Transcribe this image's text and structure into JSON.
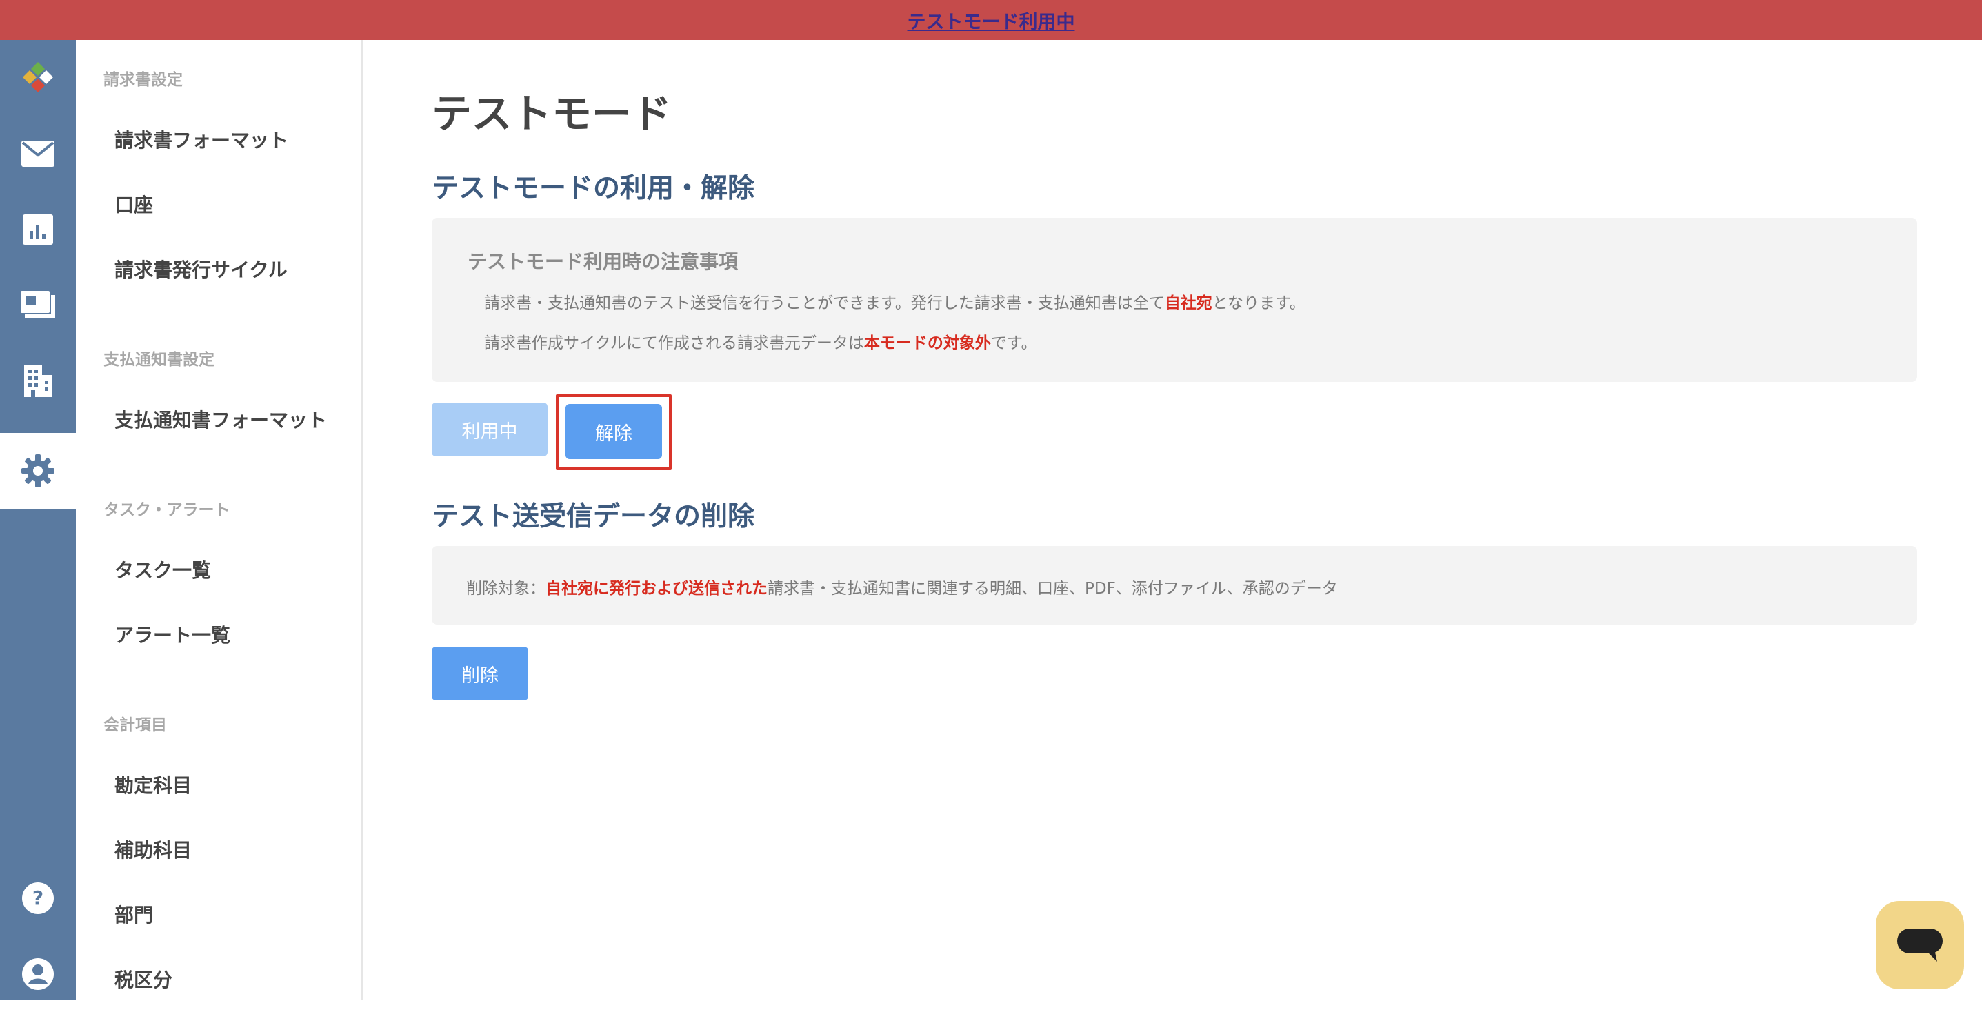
{
  "banner": {
    "text": "テストモード利用中"
  },
  "sidebar_rail": {
    "items": [
      {
        "icon": "logo-icon"
      },
      {
        "icon": "mail-icon"
      },
      {
        "icon": "chart-icon"
      },
      {
        "icon": "invoice-icon"
      },
      {
        "icon": "building-icon"
      },
      {
        "icon": "gear-icon",
        "active": true
      },
      {
        "icon": "help-icon"
      },
      {
        "icon": "user-icon"
      }
    ]
  },
  "menu": {
    "sections": [
      {
        "title": "請求書設定",
        "items": [
          "請求書フォーマット",
          "口座",
          "請求書発行サイクル"
        ]
      },
      {
        "title": "支払通知書設定",
        "items": [
          "支払通知書フォーマット"
        ]
      },
      {
        "title": "タスク・アラート",
        "items": [
          "タスク一覧",
          "アラート一覧"
        ]
      },
      {
        "title": "会計項目",
        "items": [
          "勘定科目",
          "補助科目",
          "部門",
          "税区分"
        ]
      }
    ]
  },
  "main": {
    "title": "テストモード",
    "section1": {
      "heading": "テストモードの利用・解除",
      "notice_title": "テストモード利用時の注意事項",
      "line1_pre": "請求書・支払通知書のテスト送受信を行うことができます。発行した請求書・支払通知書は全て",
      "line1_red": "自社宛",
      "line1_post": "となります。",
      "line2_pre": "請求書作成サイクルにて作成される請求書元データは",
      "line2_red": "本モードの対象外",
      "line2_post": "です。",
      "in_use_label": "利用中",
      "release_label": "解除"
    },
    "section2": {
      "heading": "テスト送受信データの削除",
      "line_pre": "削除対象：",
      "line_red": "自社宛に発行および送信された",
      "line_post": "請求書・支払通知書に関連する明細、口座、PDF、添付ファイル、承認のデータ",
      "delete_label": "削除"
    }
  },
  "colors": {
    "banner": "#c54b4b",
    "rail": "#5a7aa0",
    "primary_button": "#5b9ef0",
    "disabled_button": "#a9cdf6",
    "emphasis_red": "#d72b1f",
    "chat_button": "#f2d689"
  }
}
